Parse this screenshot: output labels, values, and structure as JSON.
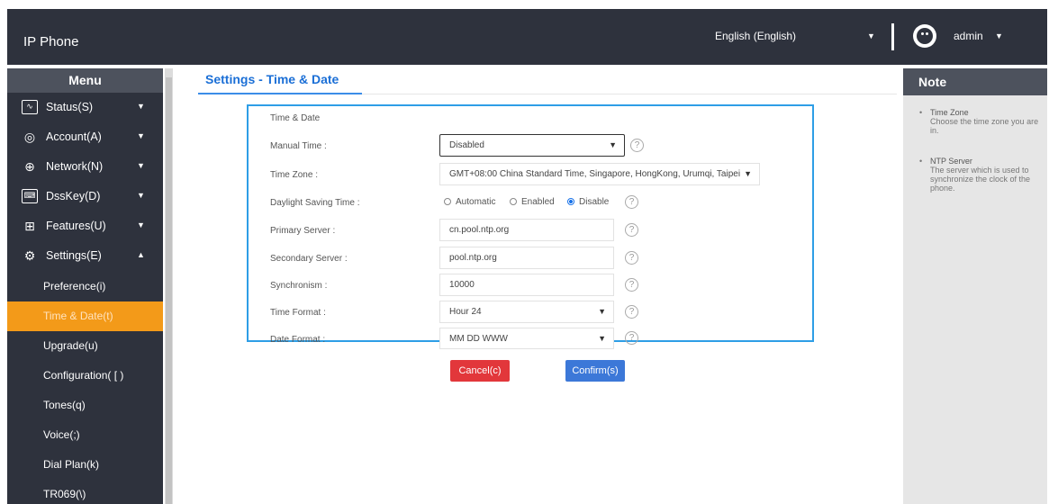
{
  "header": {
    "app_title": "IP Phone",
    "language": "English (English)",
    "user": "admin"
  },
  "sidebar": {
    "menu_title": "Menu",
    "items": [
      {
        "label": "Status(S)",
        "icon": "monitor-icon"
      },
      {
        "label": "Account(A)",
        "icon": "user-icon"
      },
      {
        "label": "Network(N)",
        "icon": "globe-icon"
      },
      {
        "label": "DssKey(D)",
        "icon": "keyboard-icon"
      },
      {
        "label": "Features(U)",
        "icon": "grid-icon"
      },
      {
        "label": "Settings(E)",
        "icon": "gear-icon"
      }
    ],
    "sub_items": [
      "Preference(i)",
      "Time & Date(t)",
      "Upgrade(u)",
      "Configuration( [ )",
      "Tones(q)",
      "Voice(;)",
      "Dial Plan(k)",
      "TR069(\\)"
    ],
    "active_sub_item": "Time & Date(t)"
  },
  "main": {
    "title": "Settings - Time & Date",
    "panel_title": "Time & Date",
    "fields": {
      "manual_time": {
        "label": "Manual Time :",
        "value": "Disabled"
      },
      "time_zone": {
        "label": "Time Zone :",
        "value": "GMT+08:00 China Standard Time, Singapore, HongKong, Urumqi, Taipei"
      },
      "daylight_saving": {
        "label": "Daylight Saving Time :",
        "options": [
          "Automatic",
          "Enabled",
          "Disable"
        ],
        "selected": "Disable"
      },
      "primary_server": {
        "label": "Primary Server :",
        "value": "cn.pool.ntp.org"
      },
      "secondary_server": {
        "label": "Secondary Server :",
        "value": "pool.ntp.org"
      },
      "synchronism": {
        "label": "Synchronism :",
        "value": "10000"
      },
      "time_format": {
        "label": "Time Format :",
        "value": "Hour 24"
      },
      "date_format": {
        "label": "Date Format :",
        "value": "MM DD WWW"
      }
    },
    "help_glyph": "?",
    "buttons": {
      "cancel": "Cancel(c)",
      "confirm": "Confirm(s)"
    }
  },
  "note": {
    "title": "Note",
    "items": [
      {
        "title": "Time Zone",
        "text": "Choose the time zone you are in."
      },
      {
        "title": "NTP Server",
        "text": "The server which is used to synchronize the clock of the phone."
      }
    ]
  },
  "colors": {
    "topbar": "#2e323d",
    "accent_orange": "#f39a19",
    "accent_blue": "#2e9ee6",
    "cancel_red": "#e2373b",
    "confirm_blue": "#3c78d8"
  }
}
